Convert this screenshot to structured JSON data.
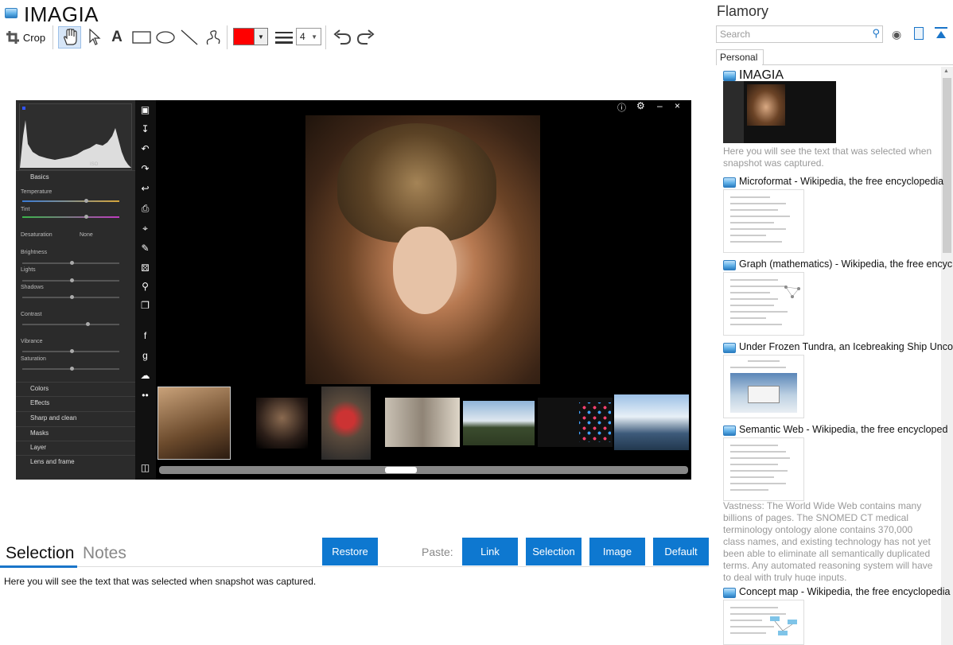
{
  "app": {
    "title": "IMAGIA"
  },
  "toolbar": {
    "crop_label": "Crop",
    "tools": [
      "hand-tool",
      "pointer-tool",
      "text-tool",
      "rectangle-tool",
      "ellipse-tool",
      "line-tool",
      "freehand-tool"
    ],
    "text_tool_glyph": "A",
    "color": "#ff0000",
    "line_width": "4"
  },
  "editor": {
    "histogram_label": "ISO",
    "basics": "Basics",
    "temperature": "Temperature",
    "tint": "Tint",
    "desaturation": "Desaturation",
    "desaturation_value": "None",
    "brightness": "Brightness",
    "lights": "Lights",
    "shadows": "Shadows",
    "contrast": "Contrast",
    "vibrance": "Vibrance",
    "saturation": "Saturation",
    "sections": [
      "Colors",
      "Effects",
      "Sharp and clean",
      "Masks",
      "Layer",
      "Lens and frame"
    ]
  },
  "bottom": {
    "tab_selection": "Selection",
    "tab_notes": "Notes",
    "restore": "Restore",
    "paste_label": "Paste:",
    "link": "Link",
    "selection": "Selection",
    "image": "Image",
    "default": "Default",
    "selected_text": "Here you will see the text that was selected when snapshot was captured."
  },
  "flamory": {
    "title": "Flamory",
    "search_placeholder": "Search",
    "tab": "Personal",
    "entries": [
      {
        "title": "IMAGIA",
        "caption": "Here you will see the text that was selected when snapshot was captured."
      },
      {
        "title": "Microformat - Wikipedia, the free encyclopedia"
      },
      {
        "title": "Graph (mathematics) - Wikipedia, the free encyc"
      },
      {
        "title": "Under Frozen Tundra, an Icebreaking Ship Unco"
      },
      {
        "title": "Semantic Web - Wikipedia, the free encycloped",
        "caption": "Vastness: The World Wide Web contains many billions of pages. The SNOMED CT medical terminology ontology alone contains 370,000 class names, and existing technology has not yet been able to eliminate all semantically duplicated terms. Any automated reasoning system will have to deal with truly huge inputs."
      },
      {
        "title": "Concept map - Wikipedia, the free encyclopedia"
      }
    ]
  }
}
